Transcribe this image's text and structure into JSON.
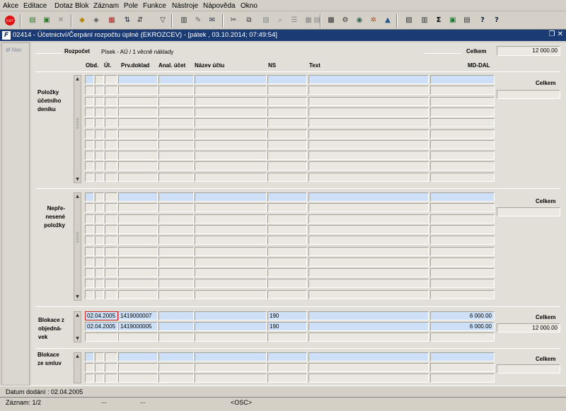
{
  "menu": [
    "Akce",
    "Editace",
    "Dotaz",
    "Blok",
    "Záznam",
    "Pole",
    "Funkce",
    "Nástroje",
    "Nápověda",
    "Okno"
  ],
  "window": {
    "title": "02414 - Účetnictví/Čerpání rozpočtu úplné (EKROZCEV) - [pátek , 03.10.2014; 07:49:54]"
  },
  "nav": {
    "label": "Nav"
  },
  "header": {
    "rozpocet_label": "Rozpočet",
    "rozpocet_value": "Písek - AÚ / 1 věcně náklady",
    "celkem_label": "Celkem",
    "celkem_value": "12 000.00"
  },
  "columns": {
    "obd": "Obd.",
    "ul": "Úl.",
    "prvdoklad": "Prv.doklad",
    "anal": "Anal. účet",
    "nazev": "Název účtu",
    "ns": "NS",
    "text": "Text",
    "mddal": "MD-DAL"
  },
  "sections": {
    "polozky": {
      "label": "Položky účetního deníku",
      "celkem_label": "Celkem",
      "celkem_value": ""
    },
    "neprenesene": {
      "label": "Nepře- nesené položky",
      "celkem_label": "Celkem",
      "celkem_value": ""
    },
    "blokace_obj": {
      "label": "Blokace z objedná- vek",
      "celkem_label": "Celkem",
      "celkem_value": "12 000.00",
      "rows": [
        {
          "obd": "02.04.2005",
          "prvdoklad": "1419000007",
          "ns": "190",
          "mddal": "6 000.00"
        },
        {
          "obd": "02.04.2005",
          "prvdoklad": "1419000005",
          "ns": "190",
          "mddal": "6 000.00"
        }
      ]
    },
    "blokace_sml": {
      "label": "Blokace ze smluv",
      "celkem_label": "Celkem",
      "celkem_value": ""
    }
  },
  "status": {
    "line1": "Datum dodání : 02.04.2005",
    "zaznam": "Záznam: 1/2",
    "dots1": "...",
    "dots2": "...",
    "mode": "<OSC>"
  }
}
